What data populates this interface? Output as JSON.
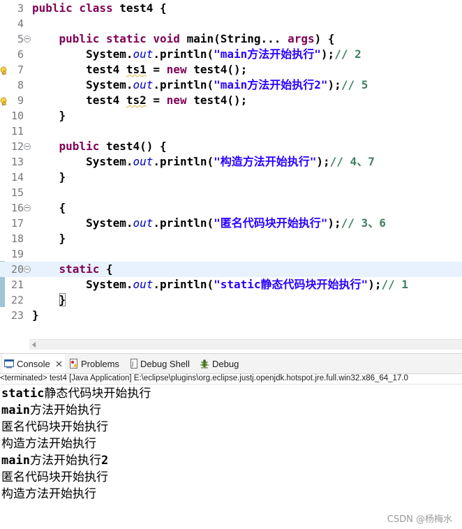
{
  "editor": {
    "lines": [
      {
        "n": "3",
        "fold": false,
        "warn": false,
        "current": false,
        "parts": [
          [
            "kw",
            "public class "
          ],
          [
            "p",
            "test4 {"
          ]
        ]
      },
      {
        "n": "4",
        "fold": false,
        "warn": false,
        "current": false,
        "parts": []
      },
      {
        "n": "5",
        "fold": true,
        "warn": false,
        "current": false,
        "parts": [
          [
            "p",
            "    "
          ],
          [
            "kw",
            "public static void "
          ],
          [
            "p",
            "main(String... "
          ],
          [
            "kw",
            "args"
          ],
          [
            "p",
            ") {"
          ]
        ]
      },
      {
        "n": "6",
        "fold": false,
        "warn": false,
        "current": false,
        "parts": [
          [
            "p",
            "        System."
          ],
          [
            "fld",
            "out"
          ],
          [
            "p",
            ".println("
          ],
          [
            "str",
            "\"main方法开始执行\""
          ],
          [
            "p",
            ");"
          ],
          [
            "cmt",
            "// 2"
          ]
        ]
      },
      {
        "n": "7",
        "fold": false,
        "warn": true,
        "current": false,
        "parts": [
          [
            "p",
            "        test4 "
          ],
          [
            "wv",
            "ts1"
          ],
          [
            "p",
            " = "
          ],
          [
            "kw",
            "new "
          ],
          [
            "p",
            "test4();"
          ]
        ]
      },
      {
        "n": "8",
        "fold": false,
        "warn": false,
        "current": false,
        "parts": [
          [
            "p",
            "        System."
          ],
          [
            "fld",
            "out"
          ],
          [
            "p",
            ".println("
          ],
          [
            "str",
            "\"main方法开始执行2\""
          ],
          [
            "p",
            ");"
          ],
          [
            "cmt",
            "// 5"
          ]
        ]
      },
      {
        "n": "9",
        "fold": false,
        "warn": true,
        "current": false,
        "parts": [
          [
            "p",
            "        test4 "
          ],
          [
            "wv",
            "ts2"
          ],
          [
            "p",
            " = "
          ],
          [
            "kw",
            "new "
          ],
          [
            "p",
            "test4();"
          ]
        ]
      },
      {
        "n": "10",
        "fold": false,
        "warn": false,
        "current": false,
        "parts": [
          [
            "p",
            "    }"
          ]
        ]
      },
      {
        "n": "11",
        "fold": false,
        "warn": false,
        "current": false,
        "parts": []
      },
      {
        "n": "12",
        "fold": true,
        "warn": false,
        "current": false,
        "parts": [
          [
            "p",
            "    "
          ],
          [
            "kw",
            "public "
          ],
          [
            "p",
            "test4() {"
          ]
        ]
      },
      {
        "n": "13",
        "fold": false,
        "warn": false,
        "current": false,
        "parts": [
          [
            "p",
            "        System."
          ],
          [
            "fld",
            "out"
          ],
          [
            "p",
            ".println("
          ],
          [
            "str",
            "\"构造方法开始执行\""
          ],
          [
            "p",
            ");"
          ],
          [
            "cmt",
            "// 4、7"
          ]
        ]
      },
      {
        "n": "14",
        "fold": false,
        "warn": false,
        "current": false,
        "parts": [
          [
            "p",
            "    }"
          ]
        ]
      },
      {
        "n": "15",
        "fold": false,
        "warn": false,
        "current": false,
        "parts": []
      },
      {
        "n": "16",
        "fold": true,
        "warn": false,
        "current": false,
        "parts": [
          [
            "p",
            "    {"
          ]
        ]
      },
      {
        "n": "17",
        "fold": false,
        "warn": false,
        "current": false,
        "parts": [
          [
            "p",
            "        System."
          ],
          [
            "fld",
            "out"
          ],
          [
            "p",
            ".println("
          ],
          [
            "str",
            "\"匿名代码块开始执行\""
          ],
          [
            "p",
            ");"
          ],
          [
            "cmt",
            "// 3、6"
          ]
        ]
      },
      {
        "n": "18",
        "fold": false,
        "warn": false,
        "current": false,
        "parts": [
          [
            "p",
            "    }"
          ]
        ]
      },
      {
        "n": "19",
        "fold": false,
        "warn": false,
        "current": false,
        "parts": []
      },
      {
        "n": "20",
        "fold": true,
        "warn": false,
        "current": true,
        "parts": [
          [
            "p",
            "    "
          ],
          [
            "kw",
            "static "
          ],
          [
            "p",
            "{"
          ]
        ]
      },
      {
        "n": "21",
        "fold": false,
        "warn": false,
        "current": false,
        "parts": [
          [
            "p",
            "        System."
          ],
          [
            "fld",
            "out"
          ],
          [
            "p",
            ".println("
          ],
          [
            "str",
            "\"static静态代码块开始执行\""
          ],
          [
            "p",
            ");"
          ],
          [
            "cmt",
            "// 1"
          ]
        ]
      },
      {
        "n": "22",
        "fold": false,
        "warn": false,
        "current": false,
        "parts": [
          [
            "p",
            "    "
          ],
          [
            "box",
            "}"
          ]
        ]
      },
      {
        "n": "23",
        "fold": false,
        "warn": false,
        "current": false,
        "parts": [
          [
            "p",
            "}"
          ]
        ]
      }
    ]
  },
  "tabs": [
    {
      "label": "Console",
      "icon": "console-icon",
      "active": true,
      "closable": true
    },
    {
      "label": "Problems",
      "icon": "problems-icon",
      "active": false,
      "closable": false
    },
    {
      "label": "Debug Shell",
      "icon": "debug-shell-icon",
      "active": false,
      "closable": false
    },
    {
      "label": "Debug",
      "icon": "debug-icon",
      "active": false,
      "closable": false
    }
  ],
  "console": {
    "status": "<terminated> test4 [Java Application] E:\\eclipse\\plugins\\org.eclipse.justj.openjdk.hotspot.jre.full.win32.x86_64_17.0",
    "output": [
      [
        [
          "m",
          "static"
        ],
        [
          "c",
          "静态代码块开始执行"
        ]
      ],
      [
        [
          "m",
          "main"
        ],
        [
          "c",
          "方法开始执行"
        ]
      ],
      [
        [
          "c",
          "匿名代码块开始执行"
        ]
      ],
      [
        [
          "c",
          "构造方法开始执行"
        ]
      ],
      [
        [
          "m",
          "main"
        ],
        [
          "c",
          "方法开始执行"
        ],
        [
          "m",
          "2"
        ]
      ],
      [
        [
          "c",
          "匿名代码块开始执行"
        ]
      ],
      [
        [
          "c",
          "构造方法开始执行"
        ]
      ]
    ]
  },
  "watermark": "CSDN @杨梅水",
  "colors": {
    "keyword": "#7f0055",
    "string": "#2a00ff",
    "field": "#0000c0",
    "comment": "#3f7f5f",
    "current_line": "#e8f2fe",
    "line_number": "#787878"
  }
}
